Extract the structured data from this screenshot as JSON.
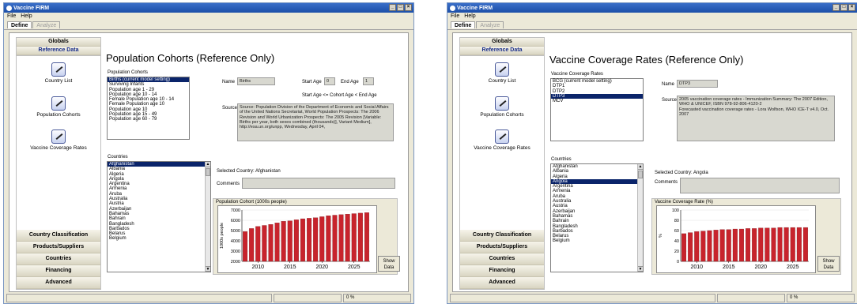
{
  "left": {
    "window_title": "Vaccine FIRM",
    "menu": [
      "File",
      "Help"
    ],
    "tabs": {
      "define": "Define",
      "analyze": "Analyze"
    },
    "sidebar": {
      "globals": "Globals",
      "reference_data": "Reference Data",
      "nav": [
        {
          "label": "Country List",
          "icon": "pencil-document-icon"
        },
        {
          "label": "Population Cohorts",
          "icon": "pencil-document-icon"
        },
        {
          "label": "Vaccine Coverage Rates",
          "icon": "pencil-document-icon"
        }
      ],
      "bottom": [
        "Country Classification",
        "Products/Suppliers",
        "Countries",
        "Financing",
        "Advanced"
      ]
    },
    "heading": "Population Cohorts (Reference Only)",
    "list_label": "Population Cohorts",
    "list_items": [
      "Births (current model setting)",
      "Surviving Infants",
      "Population age 1 - 29",
      "Population age 10 - 14",
      "Female Population age 10 - 14",
      "Female Population age 10",
      "Population age 10",
      "Population age 15 - 49",
      "Population age 60 - 79"
    ],
    "selected_index": 0,
    "name_label": "Name",
    "name_value": "Births",
    "start_age_label": "Start Age",
    "start_age_value": "0",
    "end_age_label": "End Age",
    "end_age_value": "1",
    "age_rule": "Start Age  <=  Cohort Age  <  End Age",
    "source_label": "Source",
    "source_text": "Source: Population Division of the Department of Economic and Social Affairs of the United Nations Secretariat, World Population Prospects: The 2006 Revision and World Urbanization Prospects: The 2005 Revision [Variable:  Births per year, both sexes combined (thousands)], Variant Medium], http://esa.un.org/unpp, Wednesday, April 04,",
    "countries_label": "Countries",
    "countries": [
      "Afghanistan",
      "Albania",
      "Algeria",
      "Angola",
      "Argentina",
      "Armenia",
      "Aruba",
      "Australia",
      "Austria",
      "Azerbaijan",
      "Bahamas",
      "Bahrain",
      "Bangladesh",
      "Barbados",
      "Belarus",
      "Belgium"
    ],
    "country_selected_index": 0,
    "selected_country": "Selected Country: Afghanistan",
    "comments_label": "Comments",
    "chart_title": "Population Cohort (1000s people)",
    "show_button": [
      "Show",
      "Data"
    ],
    "status_right": "0 %"
  },
  "right": {
    "window_title": "Vaccine FIRM",
    "menu": [
      "File",
      "Help"
    ],
    "tabs": {
      "define": "Define",
      "analyze": "Analyze"
    },
    "sidebar": {
      "globals": "Globals",
      "reference_data": "Reference Data",
      "nav": [
        {
          "label": "Country List",
          "icon": "pencil-document-icon"
        },
        {
          "label": "Population Cohorts",
          "icon": "pencil-document-icon"
        },
        {
          "label": "Vaccine Coverage Rates",
          "icon": "pencil-document-icon"
        }
      ],
      "bottom": [
        "Country Classification",
        "Products/Suppliers",
        "Countries",
        "Financing",
        "Advanced"
      ]
    },
    "heading": "Vaccine Coverage Rates (Reference Only)",
    "list_label": "Vaccine Coverage Rates",
    "list_items": [
      "BCG (current model setting)",
      "DTP1",
      "DTP2",
      "DTP3",
      "MCV"
    ],
    "selected_index": 3,
    "name_label": "Name",
    "name_value": "DTP3",
    "source_label": "Source",
    "source_text": "2005 vaccination coverage rates - Immunization Summary: The 2007 Edition, WHO & UNICEF, ISBN 978-92-806-4120-2\nForecasted vaccination coverage rates - Lora Wolfson, WHO ICE-T v4.0, Oct. 2007",
    "countries_label": "Countries",
    "countries": [
      "Afghanistan",
      "Albania",
      "Algeria",
      "Angola",
      "Argentina",
      "Armenia",
      "Aruba",
      "Australia",
      "Austria",
      "Azerbaijan",
      "Bahamas",
      "Bahrain",
      "Bangladesh",
      "Barbados",
      "Belarus",
      "Belgium"
    ],
    "country_selected_index": 3,
    "selected_country": "Selected Country: Angola",
    "comments_label": "Comments",
    "chart_title": "Vaccine Coverage Rate (%)",
    "show_button": [
      "Show",
      "Data"
    ],
    "status_right": "0 %"
  },
  "chart_data": [
    {
      "type": "bar",
      "title": "Population Cohort (1000s people)",
      "ylabel": "1000s people",
      "x": [
        2008,
        2009,
        2010,
        2011,
        2012,
        2013,
        2014,
        2015,
        2016,
        2017,
        2018,
        2019,
        2020,
        2021,
        2022,
        2023,
        2024,
        2025,
        2026,
        2027
      ],
      "values": [
        4900,
        5200,
        5400,
        5500,
        5600,
        5750,
        5900,
        5950,
        6050,
        6150,
        6200,
        6250,
        6350,
        6450,
        6500,
        6550,
        6600,
        6650,
        6700,
        6750
      ],
      "yticks": [
        2000,
        3000,
        4000,
        5000,
        6000,
        7000
      ],
      "ylim": [
        2000,
        7000
      ],
      "xticks": [
        2010,
        2015,
        2020,
        2025
      ],
      "color": "#c8232c"
    },
    {
      "type": "bar",
      "title": "Vaccine Coverage Rate (%)",
      "ylabel": "%",
      "x": [
        2008,
        2009,
        2010,
        2011,
        2012,
        2013,
        2014,
        2015,
        2016,
        2017,
        2018,
        2019,
        2020,
        2021,
        2022,
        2023,
        2024,
        2025,
        2026,
        2027
      ],
      "values": [
        54,
        56,
        58,
        59,
        60,
        61,
        62,
        62,
        63,
        63,
        64,
        64,
        65,
        65,
        65,
        66,
        66,
        66,
        66,
        66
      ],
      "yticks": [
        0,
        20,
        40,
        60,
        80,
        100
      ],
      "ylim": [
        0,
        100
      ],
      "xticks": [
        2010,
        2015,
        2020,
        2025
      ],
      "color": "#c8232c"
    }
  ]
}
